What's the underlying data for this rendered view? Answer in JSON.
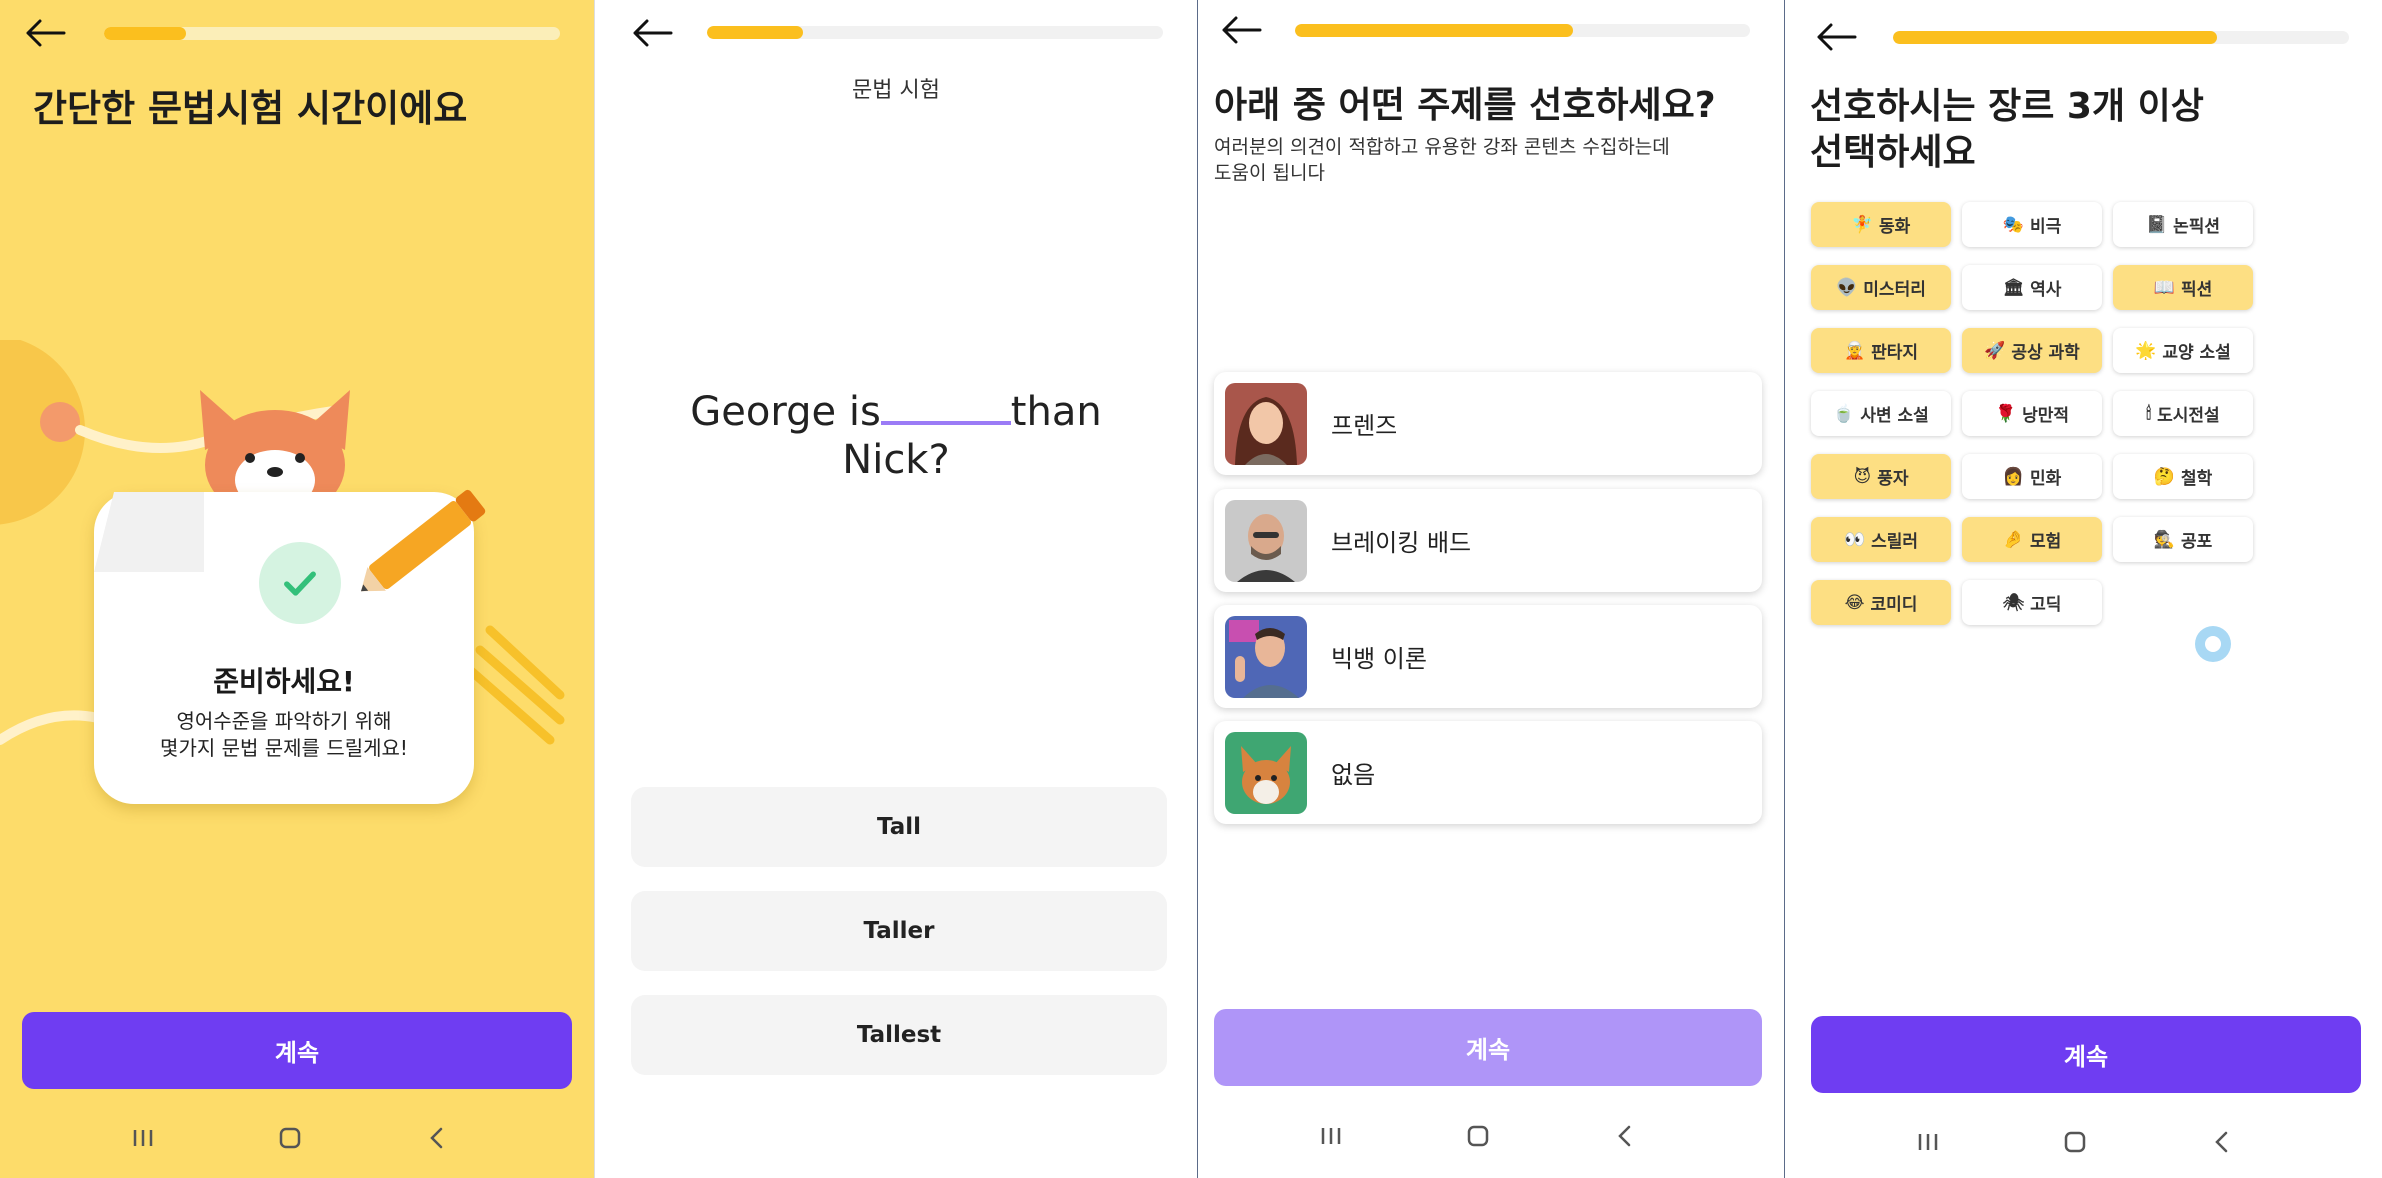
{
  "colors": {
    "accent": "#6F3DF2",
    "accent_disabled": "#AF95F8",
    "progress": "#FBBF1E",
    "selected_chip": "#FDDF83",
    "intro_bg": "#FDDC6A"
  },
  "screen1": {
    "progress": 0.18,
    "title": "간단한 문법시험 시간이에요",
    "card_title": "준비하세요!",
    "card_desc_line1": "영어수준을 파악하기 위해",
    "card_desc_line2": "몇가지 문법 문제를 드릴게요!",
    "continue": "계속"
  },
  "screen2": {
    "progress": 0.21,
    "header": "문법 시험",
    "question_part1": "George is",
    "question_part2": "than",
    "question_part3": "Nick?",
    "options": [
      "Tall",
      "Taller",
      "Tallest"
    ]
  },
  "screen3": {
    "progress": 0.61,
    "title": "아래 중 어떤 주제를 선호하세요?",
    "subtitle_line1": "여러분의 의견이 적합하고 유용한 강좌 콘텐츠 수집하는데",
    "subtitle_line2": "도움이 됩니다",
    "topics": [
      {
        "label": "프렌즈",
        "icon": "woman-avatar"
      },
      {
        "label": "브레이킹 배드",
        "icon": "bald-man-avatar"
      },
      {
        "label": "빅뱅 이론",
        "icon": "man-waving-avatar"
      },
      {
        "label": "없음",
        "icon": "corgi-avatar"
      }
    ],
    "continue": "계속"
  },
  "screen4": {
    "progress": 0.71,
    "title_line1": "선호하시는 장르 3개 이상",
    "title_line2": "선택하세요",
    "genres": [
      {
        "emoji": "🧚",
        "label": "동화",
        "selected": true
      },
      {
        "emoji": "🎭",
        "label": "비극",
        "selected": false
      },
      {
        "emoji": "📓",
        "label": "논픽션",
        "selected": false
      },
      {
        "emoji": "👽",
        "label": "미스터리",
        "selected": true
      },
      {
        "emoji": "🏛",
        "label": "역사",
        "selected": false
      },
      {
        "emoji": "📖",
        "label": "픽션",
        "selected": true
      },
      {
        "emoji": "🧝",
        "label": "판타지",
        "selected": true
      },
      {
        "emoji": "🚀",
        "label": "공상 과학",
        "selected": true
      },
      {
        "emoji": "🌟",
        "label": "교양 소설",
        "selected": false
      },
      {
        "emoji": "🍵",
        "label": "사변 소설",
        "selected": false
      },
      {
        "emoji": "🌹",
        "label": "낭만적",
        "selected": false
      },
      {
        "emoji": "🕯",
        "label": "도시전설",
        "selected": false
      },
      {
        "emoji": "😈",
        "label": "풍자",
        "selected": true
      },
      {
        "emoji": "👩",
        "label": "민화",
        "selected": false
      },
      {
        "emoji": "🤔",
        "label": "철학",
        "selected": false
      },
      {
        "emoji": "👀",
        "label": "스릴러",
        "selected": true
      },
      {
        "emoji": "🤌",
        "label": "모험",
        "selected": true
      },
      {
        "emoji": "🕵",
        "label": "공포",
        "selected": false
      },
      {
        "emoji": "😂",
        "label": "코미디",
        "selected": true
      },
      {
        "emoji": "🕷",
        "label": "고딕",
        "selected": false
      }
    ],
    "continue": "계속"
  }
}
